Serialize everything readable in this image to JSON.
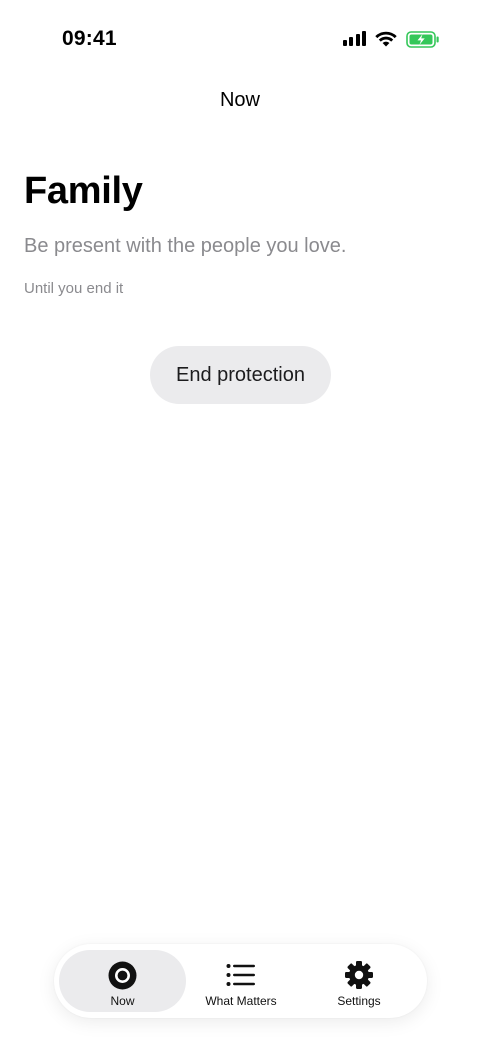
{
  "status_bar": {
    "time": "09:41",
    "icons": [
      "cellular-signal-icon",
      "wifi-icon",
      "battery-charging-icon"
    ],
    "battery_color": "#34c759"
  },
  "nav": {
    "title": "Now"
  },
  "main": {
    "heading": "Family",
    "subtitle": "Be present with the people you love.",
    "duration": "Until you end it",
    "end_button_label": "End protection"
  },
  "tab_bar": {
    "tabs": [
      {
        "label": "Now",
        "icon": "now-circle-icon",
        "active": true
      },
      {
        "label": "What Matters",
        "icon": "list-icon",
        "active": false
      },
      {
        "label": "Settings",
        "icon": "gear-icon",
        "active": false
      }
    ]
  },
  "colors": {
    "background": "#ffffff",
    "text_primary": "#000000",
    "text_secondary": "#8a8a8e",
    "button_background": "#ebebed"
  }
}
